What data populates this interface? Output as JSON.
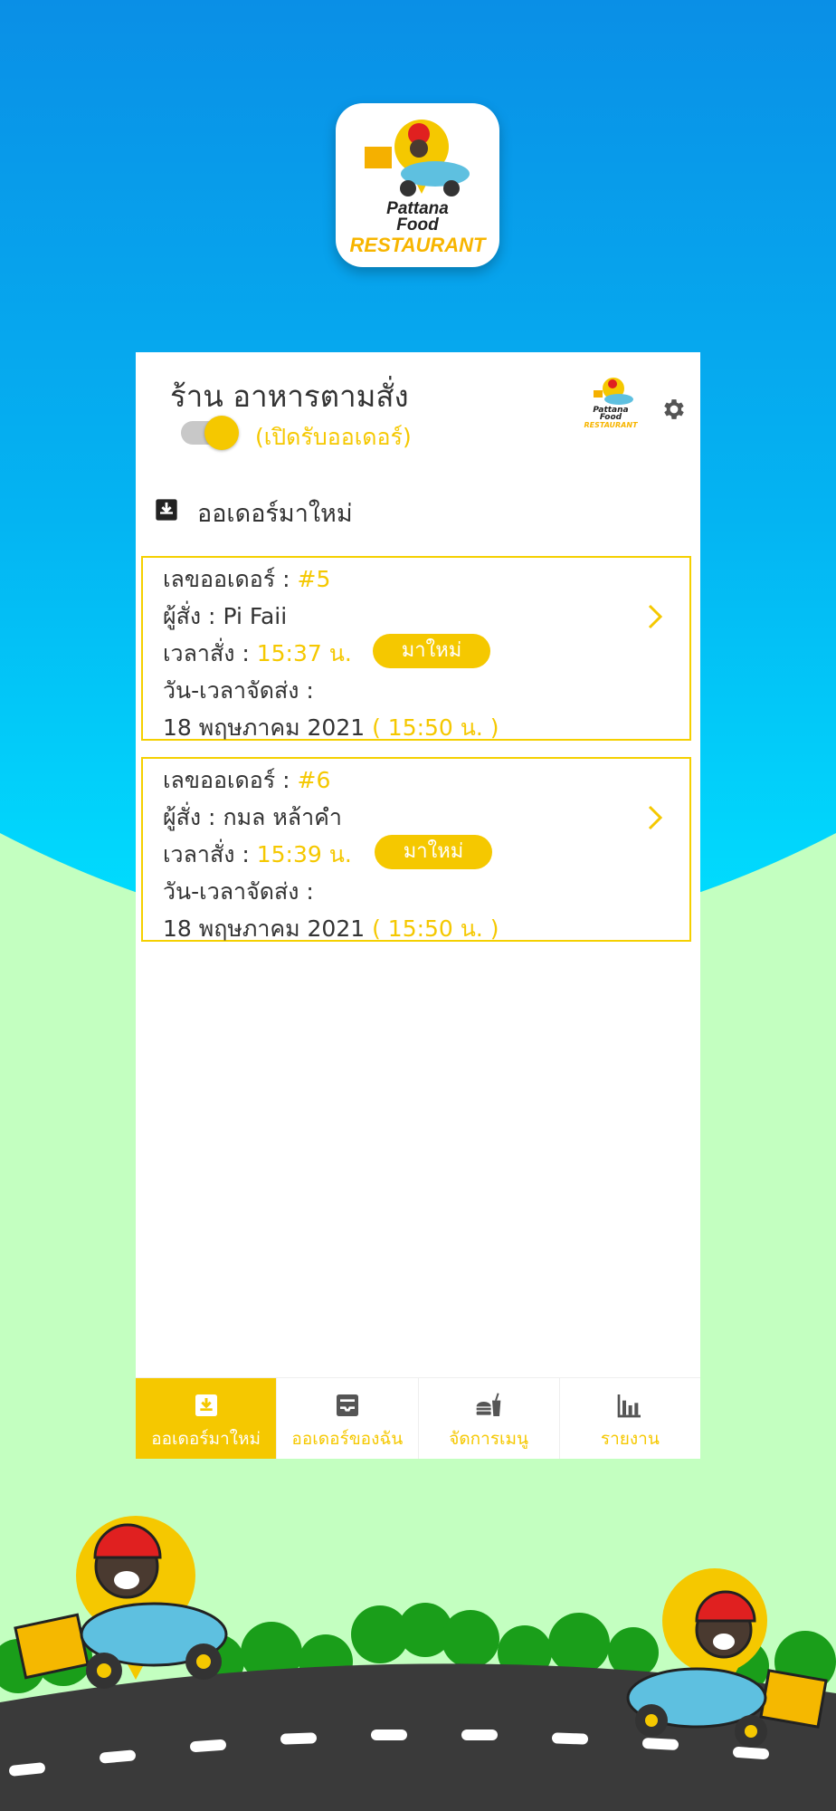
{
  "colors": {
    "accent": "#f5c800",
    "sky_top": "#0a8fe6",
    "sky_bottom": "#00d8ff",
    "ground": "#c3ffc0",
    "road": "#3a3a3a"
  },
  "app_icon": {
    "brand_line1": "Pattana",
    "brand_line2": "Food",
    "brand_line3": "RESTAURANT"
  },
  "header": {
    "shop_name": "ร้าน อาหารตามสั่ง",
    "toggle_on": true,
    "status_label": "(เปิดรับออเดอร์)",
    "mini_logo_line1": "Pattana",
    "mini_logo_line2": "Food",
    "mini_logo_line3": "RESTAURANT",
    "settings_icon": "gear-icon"
  },
  "section": {
    "icon": "inbox-download-icon",
    "title": "ออเดอร์มาใหม่"
  },
  "orders": [
    {
      "order_label": "เลขออเดอร์ : ",
      "order_no": "#5",
      "customer_label": "ผู้สั่ง : ",
      "customer": "Pi  Faii",
      "time_label": "เวลาสั่ง : ",
      "time": "15:37 น.",
      "badge": "มาใหม่",
      "delivery_label": "วัน-เวลาจัดส่ง :",
      "delivery_date": "18 พฤษภาคม 2021 ",
      "delivery_time": "( 15:50 น. )"
    },
    {
      "order_label": "เลขออเดอร์ : ",
      "order_no": "#6",
      "customer_label": "ผู้สั่ง : ",
      "customer": "กมล  หล้าคำ",
      "time_label": "เวลาสั่ง : ",
      "time": "15:39 น.",
      "badge": "มาใหม่",
      "delivery_label": "วัน-เวลาจัดส่ง :",
      "delivery_date": "18 พฤษภาคม 2021 ",
      "delivery_time": "( 15:50 น. )"
    }
  ],
  "tabs": [
    {
      "label": "ออเดอร์มาใหม่",
      "icon": "inbox-download-icon",
      "active": true
    },
    {
      "label": "ออเดอร์ของฉัน",
      "icon": "inbox-tray-icon",
      "active": false
    },
    {
      "label": "จัดการเมนู",
      "icon": "food-drink-icon",
      "active": false
    },
    {
      "label": "รายงาน",
      "icon": "bar-chart-icon",
      "active": false
    }
  ]
}
